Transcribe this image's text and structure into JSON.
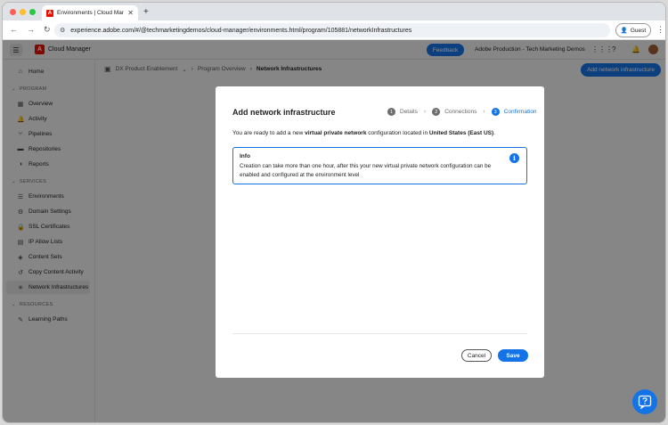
{
  "browser": {
    "tab_title": "Environments | Cloud Manage",
    "url": "experience.adobe.com/#/@techmarketingdemos/cloud-manager/environments.html/program/105881/networkInfrastructures",
    "guest_label": "Guest"
  },
  "header": {
    "app_name": "Cloud Manager",
    "feedback_label": "Feedback",
    "org_name": "Adobe Production - Tech Marketing Demos"
  },
  "sidebar": {
    "home": "Home",
    "program_section": "PROGRAM",
    "program_items": [
      "Overview",
      "Activity",
      "Pipelines",
      "Repositories",
      "Reports"
    ],
    "services_section": "SERVICES",
    "services_items": [
      "Environments",
      "Domain Settings",
      "SSL Certificates",
      "IP Allow Lists",
      "Content Sets",
      "Copy Content Activity",
      "Network Infrastructures"
    ],
    "resources_section": "RESOURCES",
    "resources_items": [
      "Learning Paths"
    ]
  },
  "breadcrumb": {
    "program": "DX Product Enablement",
    "overview": "Program Overview",
    "current": "Network Infrastructures"
  },
  "main": {
    "add_button": "Add network infrastructure"
  },
  "dialog": {
    "title": "Add network infrastructure",
    "steps": [
      {
        "num": "1",
        "label": "Details"
      },
      {
        "num": "2",
        "label": "Connections"
      },
      {
        "num": "3",
        "label": "Confirmation"
      }
    ],
    "active_step": 3,
    "msg_prefix": "You are ready to add a new ",
    "msg_bold1": "virtual private network",
    "msg_middle": " configuration located in ",
    "msg_bold2": "United States (East US)",
    "msg_suffix": ".",
    "info_title": "Info",
    "info_text": "Creation can take more than one hour, after this your new virtual private network configuration can be enabled and configured at the environment level",
    "cancel_label": "Cancel",
    "save_label": "Save"
  },
  "colors": {
    "accent": "#1473e6",
    "brand": "#eb1000"
  }
}
